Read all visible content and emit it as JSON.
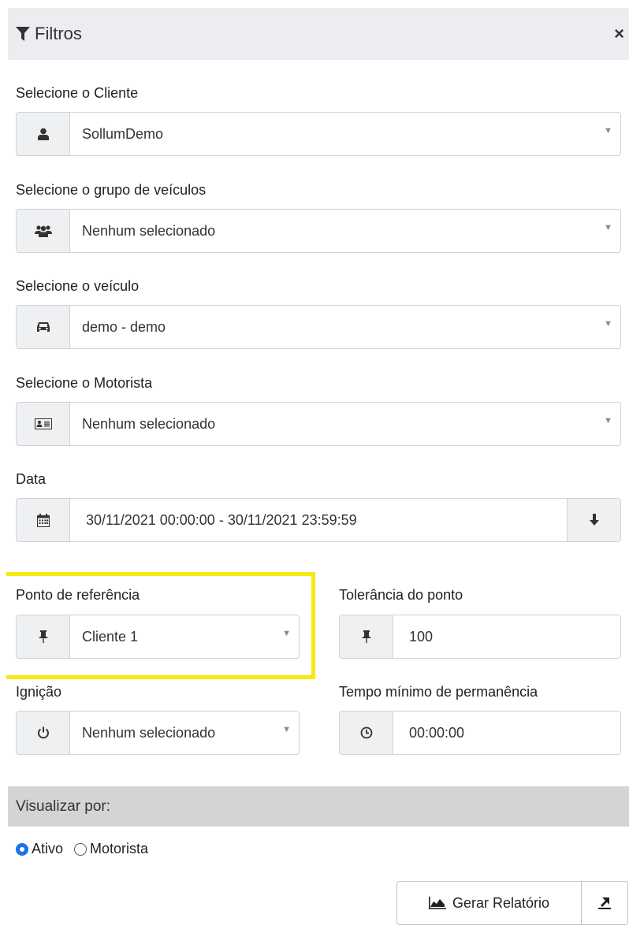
{
  "header": {
    "title": "Filtros",
    "close": "×"
  },
  "fields": {
    "cliente": {
      "label": "Selecione o Cliente",
      "value": "SollumDemo"
    },
    "grupo": {
      "label": "Selecione o grupo de veículos",
      "value": "Nenhum selecionado"
    },
    "veiculo": {
      "label": "Selecione o veículo",
      "value": "demo - demo"
    },
    "motorista": {
      "label": "Selecione o Motorista",
      "value": "Nenhum selecionado"
    },
    "data": {
      "label": "Data",
      "value": "30/11/2021 00:00:00 - 30/11/2021 23:59:59"
    },
    "ponto": {
      "label": "Ponto de referência",
      "value": "Cliente 1"
    },
    "tolerancia": {
      "label": "Tolerância do ponto",
      "value": "100"
    },
    "ignicao": {
      "label": "Ignição",
      "value": "Nenhum selecionado"
    },
    "tempo": {
      "label": "Tempo mínimo de permanência",
      "value": "00:00:00"
    }
  },
  "visualizar": {
    "title": "Visualizar por:",
    "options": [
      {
        "label": "Ativo",
        "checked": true
      },
      {
        "label": "Motorista",
        "checked": false
      }
    ]
  },
  "actions": {
    "generate_label": "Gerar Relatório"
  },
  "icons": {
    "filter": "filter-icon",
    "close": "close-icon",
    "user": "user-icon",
    "users": "users-icon",
    "car": "car-icon",
    "id_card": "id-card-icon",
    "calendar": "calendar-icon",
    "arrow_down": "arrow-down-icon",
    "pin": "thumbtack-icon",
    "power": "power-icon",
    "clock": "clock-icon",
    "chart": "area-chart-icon",
    "export": "export-icon"
  },
  "colors": {
    "highlight": "#f5e90f",
    "radio_checked": "#1a73e8",
    "header_bg": "#ebedf0",
    "section_bg": "#d4d4d4"
  }
}
